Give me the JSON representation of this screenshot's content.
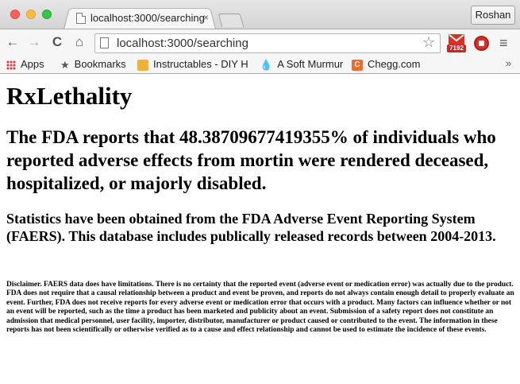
{
  "browser": {
    "tab": {
      "title": "localhost:3000/searching",
      "close": "×"
    },
    "profile": "Roshan",
    "address_bar": {
      "url": "localhost:3000/searching"
    },
    "toolbar_icons": {
      "back": "←",
      "forward": "→",
      "reload": "C",
      "home": "⌂",
      "star": "☆",
      "menu": "≡"
    },
    "extensions": {
      "gmail_count": "7192"
    },
    "bookmarks": [
      {
        "label": "Apps",
        "icon": "apps-grid-icon"
      },
      {
        "label": "Bookmarks",
        "icon": "star-icon",
        "glyph": "★"
      },
      {
        "label": "Instructables - DIY H",
        "icon": "instructables-icon"
      },
      {
        "label": "A Soft Murmur",
        "icon": "water-drop-icon",
        "glyph": "💧"
      },
      {
        "label": "Chegg.com",
        "icon": "chegg-icon",
        "glyph": "C"
      }
    ],
    "bookmarks_overflow": "»"
  },
  "page": {
    "title": "RxLethality",
    "headline": "The FDA reports that 48.38709677419355% of individuals who reported adverse effects from mortin were rendered deceased, hospitalized, or majorly disabled.",
    "statistics": "Statistics have been obtained from the FDA Adverse Event Reporting System (FAERS). This database includes publically released records between 2004-2013.",
    "disclaimer": "Disclaimer. FAERS data does have limitations. There is no certainty that the reported event (adverse event or medication error) was actually due to the product. FDA does not require that a causal relationship between a product and event be proven, and reports do not always contain enough detail to properly evaluate an event. Further, FDA does not receive reports for every adverse event or medication error that occurs with a product. Many factors can influence whether or not an event will be reported, such as the time a product has been marketed and publicity about an event. Submission of a safety report does not constitute an admission that medical personnel, user facility, importer, distributor, manufacturer or product caused or contributed to the event. The information in these reports has not been scientifically or otherwise verified as to a cause and effect relationship and cannot be used to estimate the incidence of these events."
  }
}
